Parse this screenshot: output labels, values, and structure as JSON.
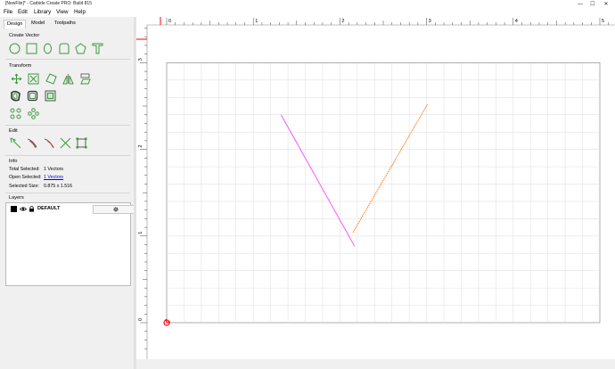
{
  "window": {
    "title": "[NewFile]* - Carbide Create PRO: Build 815",
    "minimize": "—",
    "maximize": "☐",
    "close": "✕"
  },
  "menu": [
    "File",
    "Edit",
    "Library",
    "View",
    "Help"
  ],
  "tabs": [
    "Design",
    "Model",
    "Toolpaths"
  ],
  "active_tab": "Design",
  "sections": {
    "create_vector": "Create Vector",
    "transform": "Transform",
    "edit": "Edit",
    "info": "Info",
    "layers": "Layers"
  },
  "create_vector_tools": [
    "circle-icon",
    "rectangle-icon",
    "ellipse-icon",
    "rounded-polygon-icon",
    "pentagon-icon",
    "text-icon"
  ],
  "transform_tools": [
    "move-icon",
    "scale-icon",
    "rotate-icon",
    "mirror-icon",
    "shear-icon",
    "offset-icon",
    "fillet-icon",
    "align-icon",
    "circular-array-icon",
    "grid-array-icon"
  ],
  "edit_tools": [
    "node-edit-icon",
    "join-icon",
    "trim-icon",
    "cut-icon",
    "bounding-box-icon"
  ],
  "info": {
    "total_selected_label": "Total Selected:",
    "total_selected_value": "1 Vectors",
    "open_selected_label": "Open Selected:",
    "open_selected_value": "1 Vectors",
    "selected_size_label": "Selected Size:",
    "selected_size_value": "0.875 x 1.516"
  },
  "layers": [
    {
      "name": "DEFAULT",
      "color": "#000000",
      "visible": true,
      "locked": true
    }
  ],
  "ruler": {
    "x_ticks": [
      "0",
      "1",
      "2",
      "3",
      "4",
      "5"
    ],
    "y_ticks": [
      "0",
      "1",
      "2",
      "3"
    ]
  },
  "colors": {
    "tool_green": "#3c9a3c",
    "selected_vector": "#ff44ff",
    "vector": "#ff7a1e",
    "grid": "#e2e2e2",
    "origin": "#ff0000"
  },
  "scene": {
    "units_per_grid": 0.2,
    "stock": {
      "x": [
        0,
        5
      ],
      "y": [
        0,
        3
      ]
    },
    "vectors": [
      {
        "name": "selected-vector",
        "points": [
          [
            1.32,
            2.4
          ],
          [
            2.17,
            0.88
          ]
        ],
        "color": "#ff44ff",
        "selected": true
      },
      {
        "name": "vector-orange",
        "points": [
          [
            2.15,
            1.04
          ],
          [
            3.01,
            2.52
          ]
        ],
        "color": "#ff7a1e",
        "selected": false
      }
    ]
  }
}
